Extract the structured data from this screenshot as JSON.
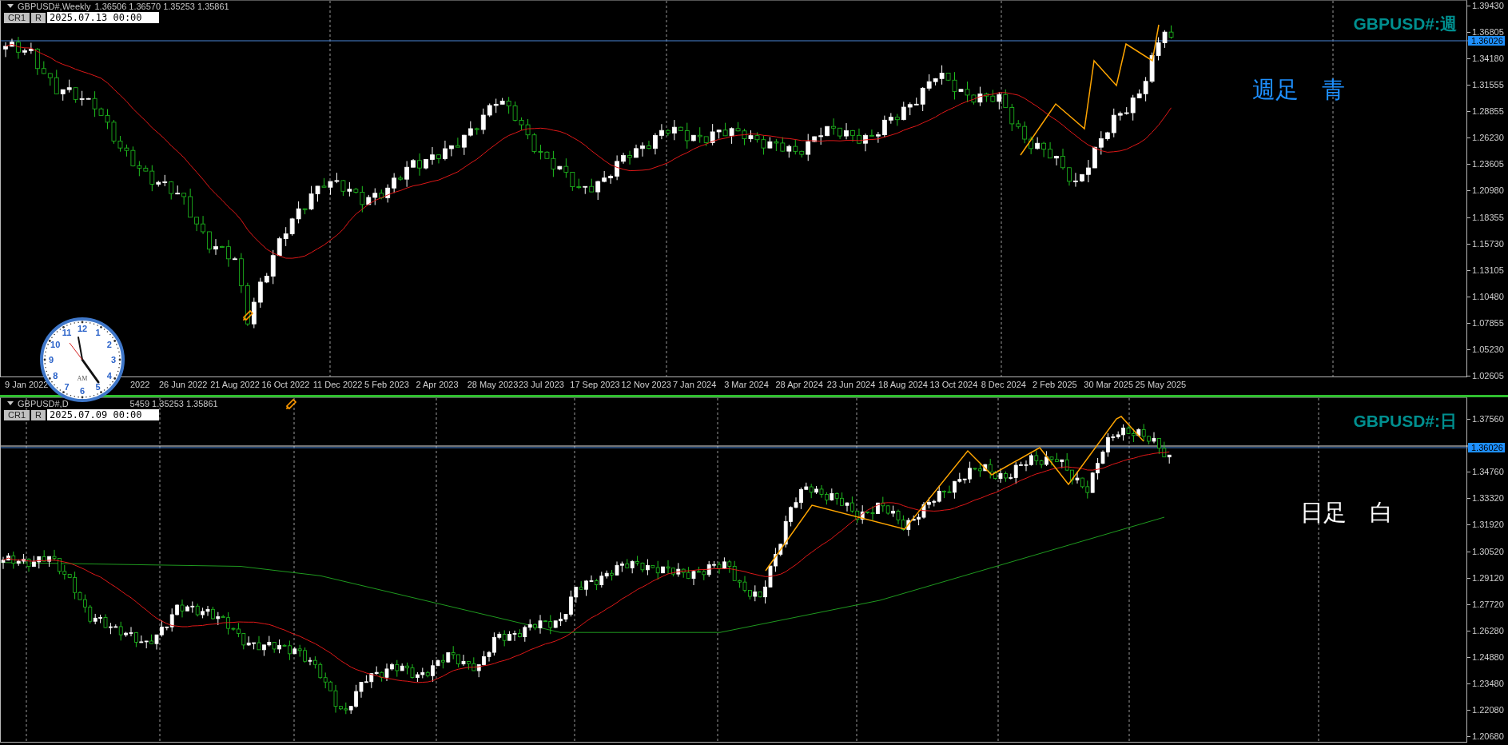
{
  "panes": [
    {
      "kind": "weekly",
      "symbol": "GBPUSD#,Weekly",
      "prices": "1.36506 1.36570 1.35253 1.35861",
      "buttons": [
        "CR1",
        "R"
      ],
      "date_field": {
        "value": "2025.07.13 00:00"
      },
      "label": "GBPUSD#:週",
      "note": "週足　青",
      "current_price": "1.36026",
      "price_axis": [
        "1.39430",
        "1.36805",
        "1.34180",
        "1.31555",
        "1.28855",
        "1.26230",
        "1.23605",
        "1.20980",
        "1.18355",
        "1.15730",
        "1.13105",
        "1.10480",
        "1.07855",
        "1.05230",
        "1.02605"
      ],
      "time_axis": [
        "9 Jan 2022",
        "2022",
        "26 Jun 2022",
        "21 Aug 2022",
        "16 Oct 2022",
        "11 Dec 2022",
        "5 Feb 2023",
        "2 Apr 2023",
        "28 May 2023",
        "23 Jul 2023",
        "17 Sep 2023",
        "12 Nov 2023",
        "7 Jan 2024",
        "3 Mar 2024",
        "28 Apr 2024",
        "23 Jun 2024",
        "18 Aug 2024",
        "13 Oct 2024",
        "8 Dec 2024",
        "2 Feb 2025",
        "30 Mar 2025",
        "25 May 2025"
      ]
    },
    {
      "kind": "daily",
      "symbol": "GBPUSD#,D",
      "prices": "5459 1.35253 1.35861",
      "buttons": [
        "CR1",
        "R"
      ],
      "date_field": {
        "value": "2025.07.09 00:00"
      },
      "label": "GBPUSD#:日",
      "note": "日足　白",
      "current_price": "1.36026",
      "price_axis": [
        "1.37560",
        "1.34760",
        "1.33320",
        "1.31920",
        "1.30520",
        "1.29120",
        "1.27720",
        "1.26280",
        "1.24880",
        "1.23480",
        "1.22080",
        "1.20680"
      ]
    }
  ],
  "clock": {
    "numerals": [
      "11",
      "12",
      "1",
      "10",
      "2",
      "9",
      "3",
      "8",
      "4",
      "7",
      "6",
      "5"
    ],
    "period": "AM"
  }
}
